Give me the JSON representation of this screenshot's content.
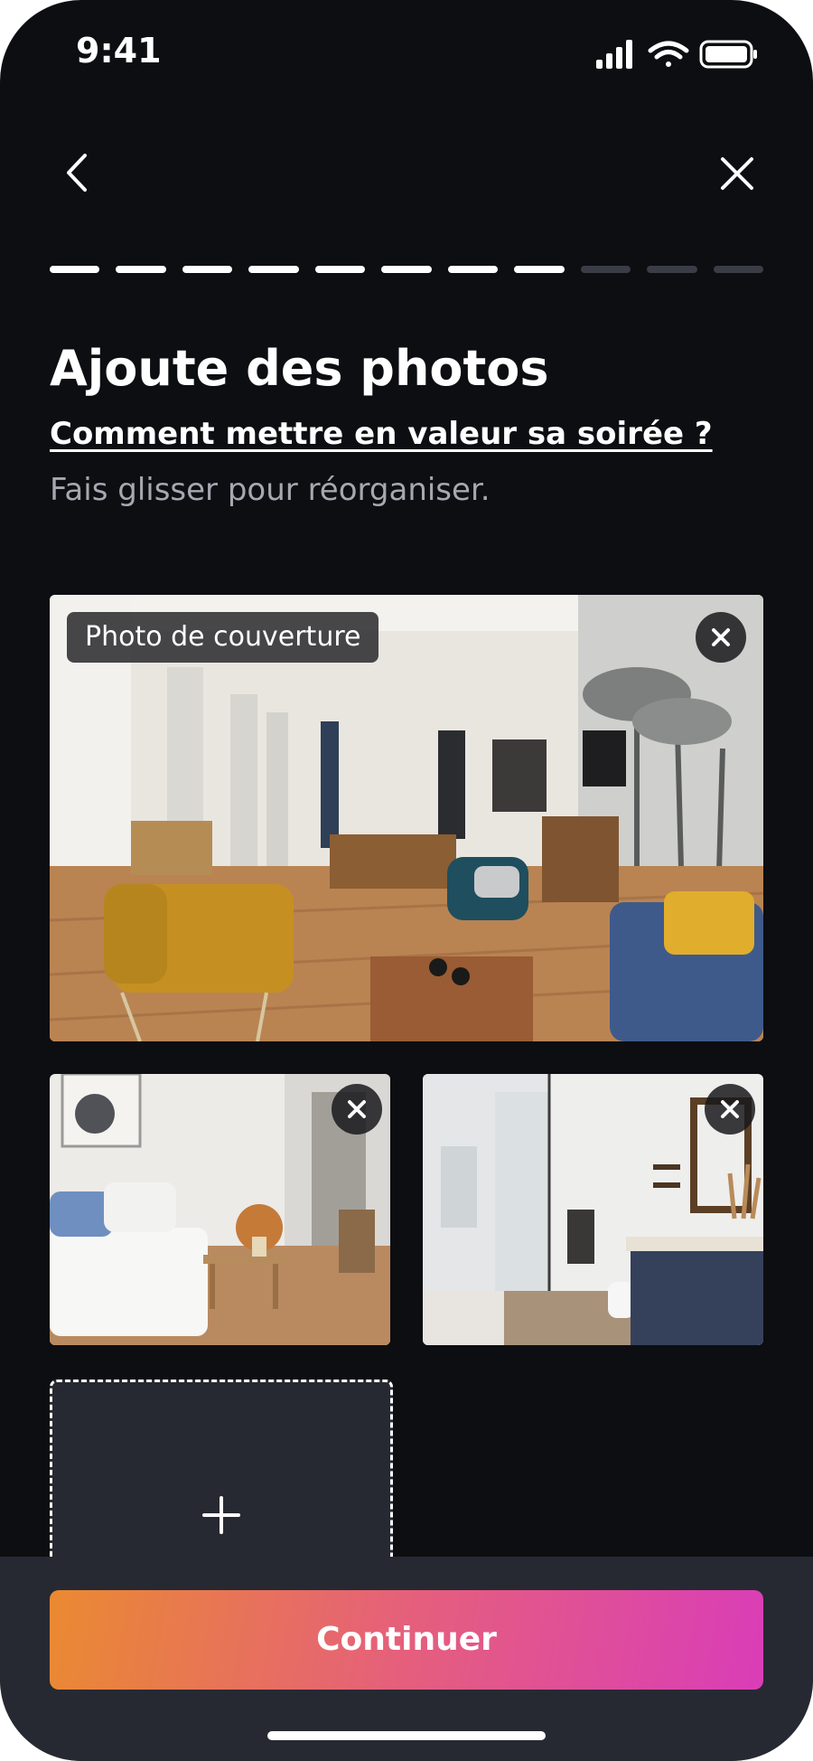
{
  "status_bar": {
    "time": "9:41"
  },
  "header": {
    "back_icon": "chevron-left-icon",
    "close_icon": "close-icon",
    "progress": {
      "total_steps": 11,
      "completed_steps": 8
    }
  },
  "content": {
    "title": "Ajoute des photos",
    "help_link": "Comment mettre en valeur sa soirée ?",
    "subtitle": "Fais glisser pour réorganiser."
  },
  "photos": [
    {
      "badge": "Photo de couverture",
      "remove_icon": "close-icon",
      "subject": "living-room"
    },
    {
      "remove_icon": "close-icon",
      "subject": "bedroom"
    },
    {
      "remove_icon": "close-icon",
      "subject": "bathroom"
    }
  ],
  "add_photo": {
    "icon": "plus-icon"
  },
  "footer": {
    "continue_label": "Continuer"
  },
  "colors": {
    "background": "#0d0e12",
    "sheet": "#272932",
    "gradient_start": "#ea8a31",
    "gradient_end": "#d93db8",
    "progress_inactive": "#3a3d45"
  }
}
